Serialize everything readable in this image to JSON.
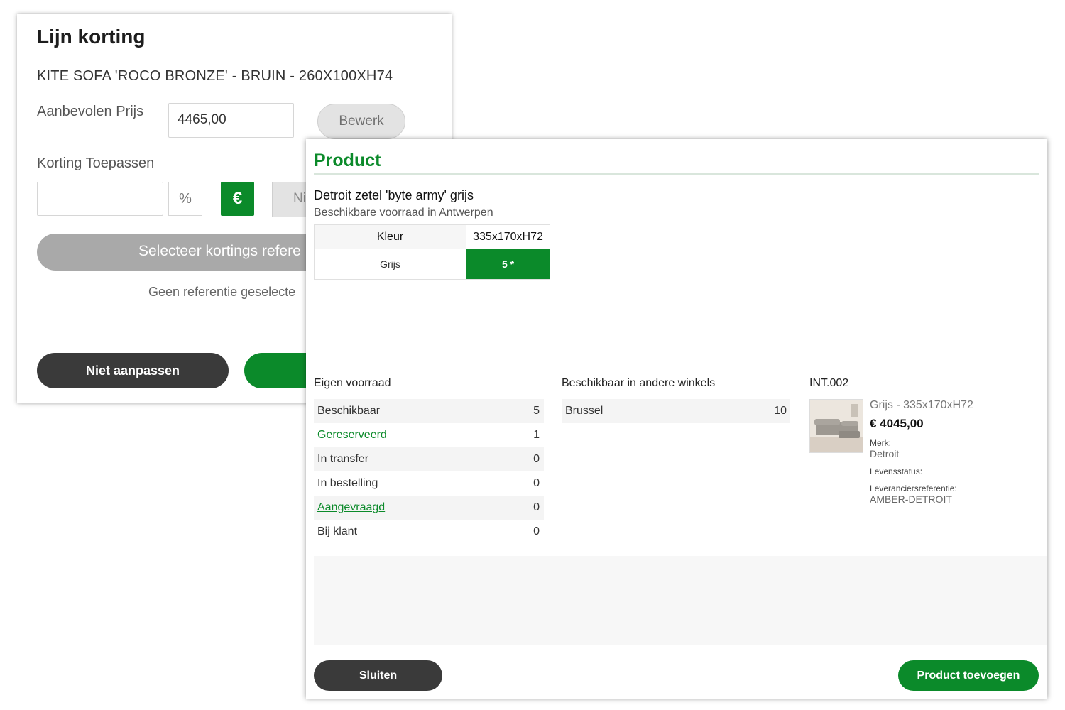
{
  "discount_dialog": {
    "title": "Lijn korting",
    "product_name": "KITE SOFA 'ROCO BRONZE' - BRUIN - 260X100XH74",
    "price_label": "Aanbevolen Prijs",
    "price_value": "4465,00",
    "edit_label": "Bewerk",
    "apply_label": "Korting Toepassen",
    "discount_value": "",
    "percent_symbol": "%",
    "euro_symbol": "€",
    "none_partial": "Ni",
    "select_ref_label": "Selecteer kortings refere",
    "no_ref_text": "Geen referentie geselecte",
    "cancel_label": "Niet aanpassen"
  },
  "product_dialog": {
    "title": "Product",
    "product_name": "Detroit zetel 'byte army' grijs",
    "availability_text": "Beschikbare voorraad in Antwerpen",
    "variant_table": {
      "header_color": "Kleur",
      "header_size": "335x170xH72",
      "row_color": "Grijs",
      "row_stock": "5 *"
    },
    "own_stock": {
      "heading": "Eigen voorraad",
      "rows": [
        {
          "label": "Beschikbaar",
          "value": "5"
        },
        {
          "label": "Gereserveerd",
          "value": "1"
        },
        {
          "label": "In transfer",
          "value": "0"
        },
        {
          "label": "In bestelling",
          "value": "0"
        },
        {
          "label": "Aangevraagd",
          "value": "0"
        },
        {
          "label": "Bij klant",
          "value": "0"
        }
      ]
    },
    "other_stores": {
      "heading": "Beschikbaar in andere winkels",
      "rows": [
        {
          "label": "Brussel",
          "value": "10"
        }
      ]
    },
    "product_card": {
      "code": "INT.002",
      "variant": "Grijs - 335x170xH72",
      "price": "€ 4045,00",
      "brand_label": "Merk:",
      "brand_value": "Detroit",
      "lifecycle_label": "Levensstatus:",
      "supplier_ref_label": "Leveranciersreferentie:",
      "supplier_ref_value": "AMBER-DETROIT"
    },
    "close_label": "Sluiten",
    "add_label": "Product toevoegen"
  },
  "colors": {
    "accent_green": "#0b8a2a",
    "dark_button": "#3a3a3a",
    "disabled_gray": "#a9a9a9"
  }
}
